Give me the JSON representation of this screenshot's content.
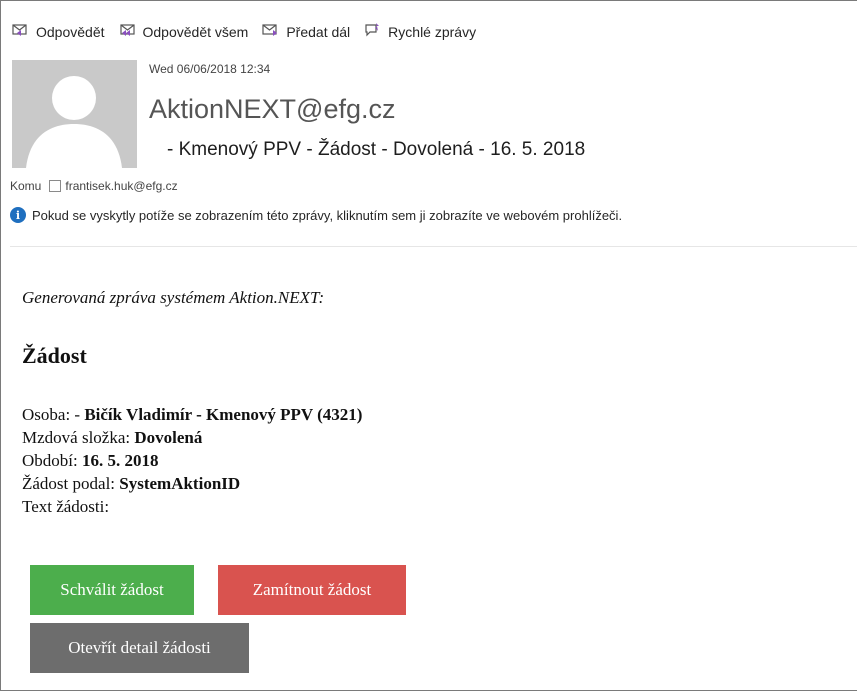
{
  "toolbar": {
    "reply_label": "Odpovědět",
    "reply_all_label": "Odpovědět všem",
    "forward_label": "Předat dál",
    "quick_messages_label": "Rychlé zprávy"
  },
  "header": {
    "date": "Wed 06/06/2018 12:34",
    "sender": "AktionNEXT@efg.cz",
    "subject": "- Kmenový PPV - Žádost - Dovolená - 16. 5. 2018",
    "to_label": "Komu",
    "to_address": "frantisek.huk@efg.cz",
    "info_message": "Pokud se vyskytly potíže se zobrazením této zprávy, kliknutím sem ji zobrazíte ve webovém prohlížeči."
  },
  "body": {
    "intro": "Generovaná zpráva systémem Aktion.NEXT:",
    "heading": "Žádost",
    "fields": {
      "person_label": "Osoba: -",
      "person_value": "Bičík Vladimír - Kmenový PPV (4321)",
      "wage_label": "Mzdová složka:",
      "wage_value": "Dovolená",
      "period_label": "Období:",
      "period_value": "16. 5. 2018",
      "submitted_label": "Žádost podal:",
      "submitted_value": "SystemAktionID",
      "text_label": "Text žádosti:"
    },
    "buttons": {
      "approve": "Schválit žádost",
      "reject": "Zamítnout žádost",
      "detail": "Otevřít detail žádosti"
    }
  },
  "colors": {
    "approve": "#4cae4c",
    "reject": "#d9534f",
    "detail": "#6d6d6d",
    "info": "#1f6fbf",
    "toolbar_icon": "#8a4fbf"
  },
  "icons": [
    "reply-icon",
    "reply-all-icon",
    "forward-icon",
    "quick-messages-icon",
    "info-icon",
    "avatar-placeholder-icon"
  ]
}
